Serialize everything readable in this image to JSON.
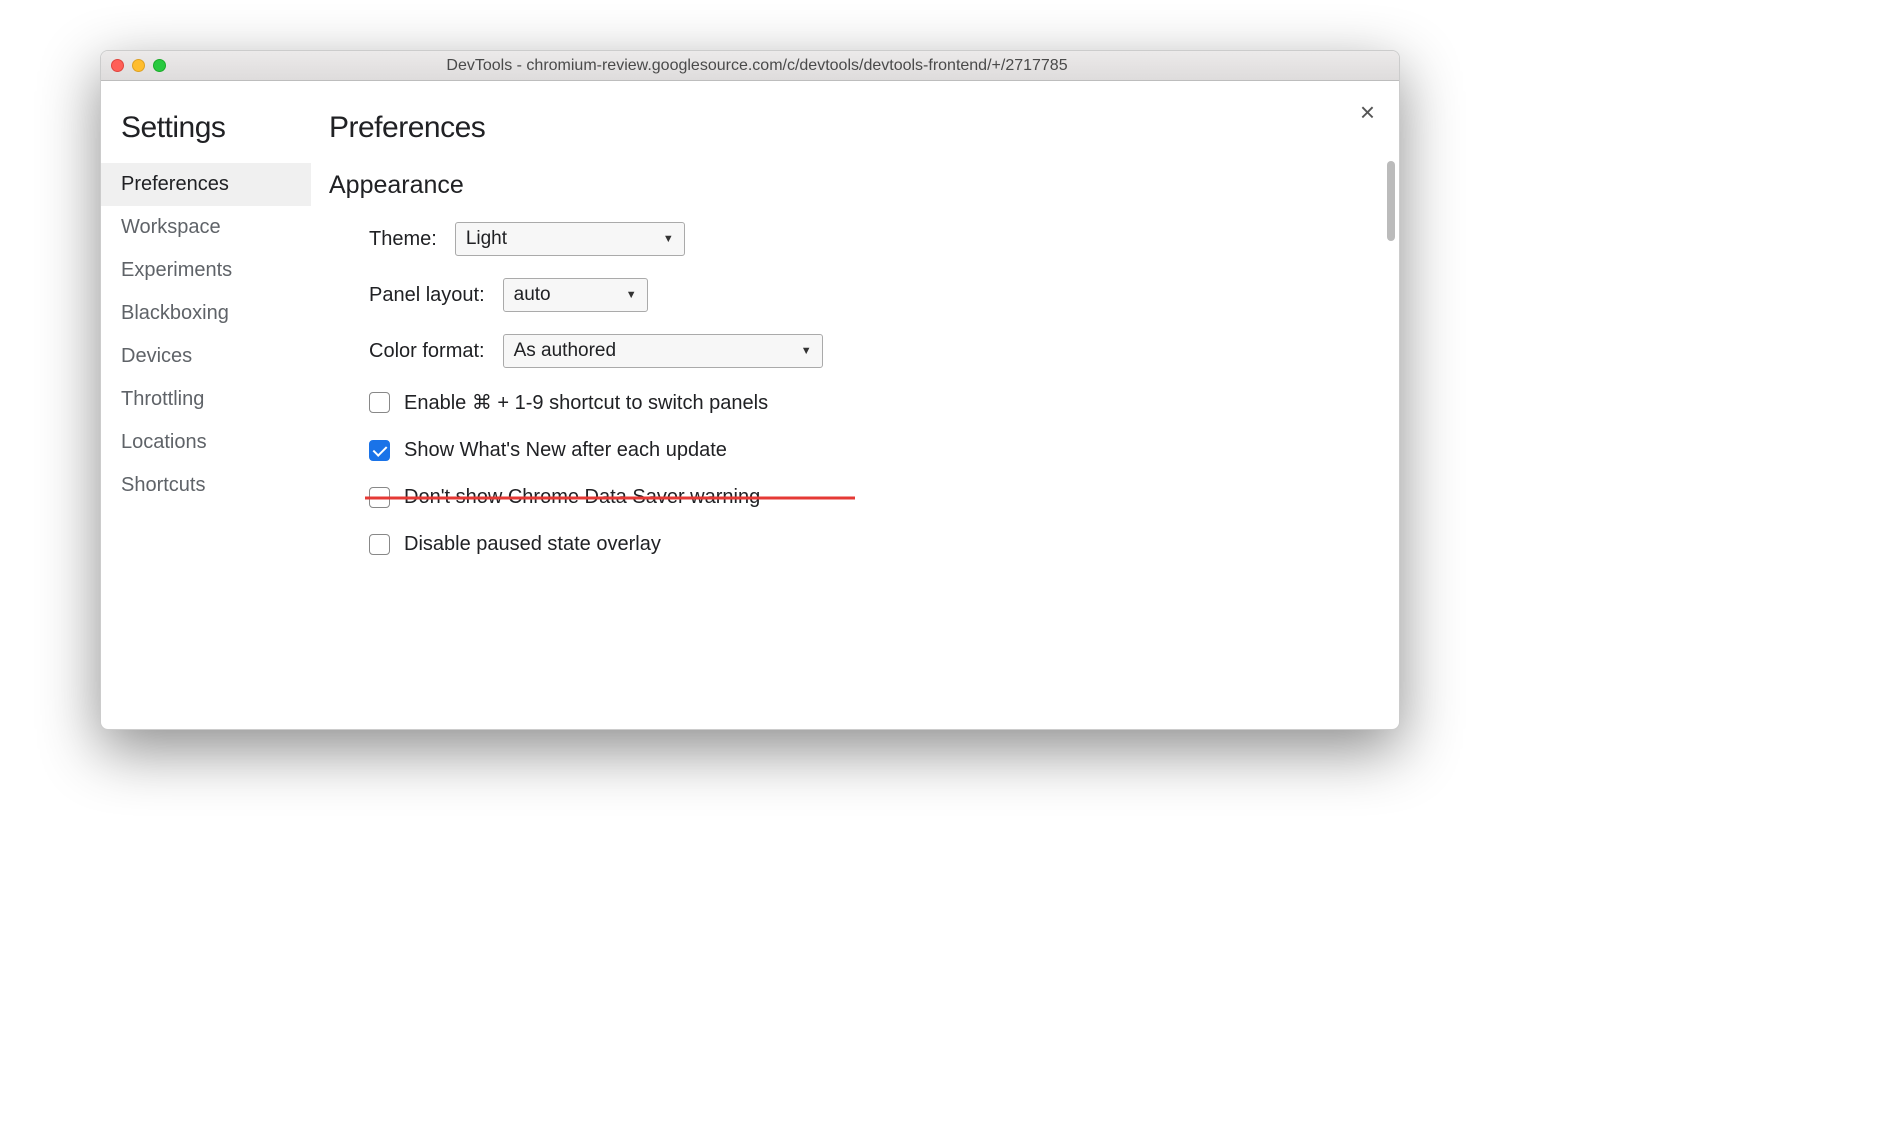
{
  "window": {
    "title": "DevTools - chromium-review.googlesource.com/c/devtools/devtools-frontend/+/2717785"
  },
  "sidebar": {
    "title": "Settings",
    "items": [
      {
        "label": "Preferences",
        "active": true
      },
      {
        "label": "Workspace",
        "active": false
      },
      {
        "label": "Experiments",
        "active": false
      },
      {
        "label": "Blackboxing",
        "active": false
      },
      {
        "label": "Devices",
        "active": false
      },
      {
        "label": "Throttling",
        "active": false
      },
      {
        "label": "Locations",
        "active": false
      },
      {
        "label": "Shortcuts",
        "active": false
      }
    ]
  },
  "main": {
    "title": "Preferences",
    "section": "Appearance",
    "theme": {
      "label": "Theme:",
      "value": "Light"
    },
    "panel_layout": {
      "label": "Panel layout:",
      "value": "auto"
    },
    "color_format": {
      "label": "Color format:",
      "value": "As authored"
    },
    "cb_shortcut": {
      "label": "Enable ⌘ + 1-9 shortcut to switch panels",
      "checked": false
    },
    "cb_whatsnew": {
      "label": "Show What's New after each update",
      "checked": true
    },
    "cb_datasaver": {
      "label": "Don't show Chrome Data Saver warning",
      "checked": false
    },
    "cb_overlay": {
      "label": "Disable paused state overlay",
      "checked": false
    }
  },
  "close_label": "×"
}
